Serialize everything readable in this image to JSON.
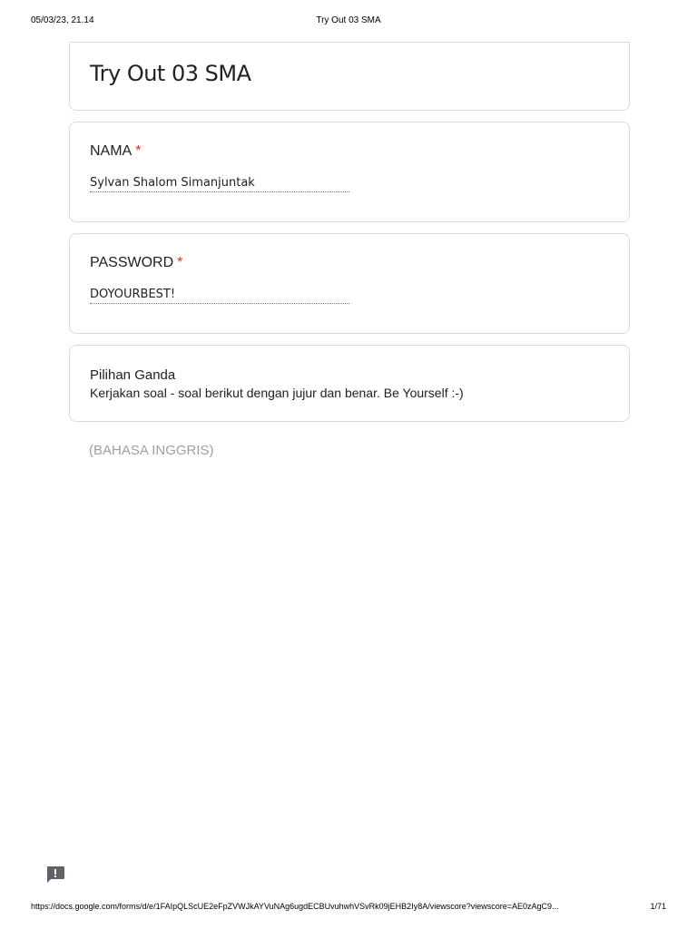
{
  "print_header": {
    "datetime": "05/03/23, 21.14",
    "title": "Try Out 03 SMA"
  },
  "form": {
    "title": "Try Out 03 SMA",
    "questions": [
      {
        "label": "NAMA",
        "required_mark": "*",
        "answer": "Sylvan Shalom Simanjuntak"
      },
      {
        "label": "PASSWORD",
        "required_mark": "*",
        "answer": "DOYOURBEST!"
      }
    ],
    "section": {
      "title": "Pilihan Ganda",
      "description": "Kerjakan soal - soal berikut dengan jujur dan benar. Be Yourself :-)"
    },
    "subsection_label": "(BAHASA INGGRIS)"
  },
  "feedback_icon": "feedback-icon",
  "print_footer": {
    "url": "https://docs.google.com/forms/d/e/1FAIpQLScUE2eFpZVWJkAYVuNAg6ugdECBUvuhwhVSvRk09jEHB2Iy8A/viewscore?viewscore=AE0zAgC9...",
    "page": "1/71"
  },
  "colors": {
    "required": "#d93025",
    "border": "#dadce0",
    "muted_text": "#9aa0a6"
  }
}
